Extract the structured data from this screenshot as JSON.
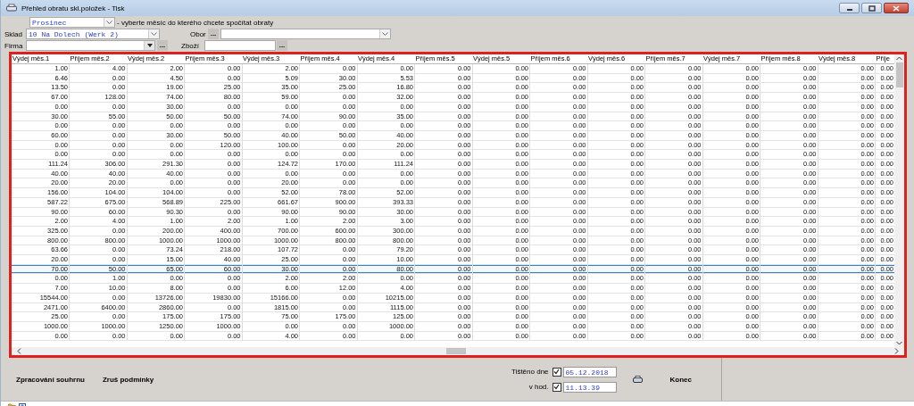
{
  "window": {
    "title": "Přehled obratu skl.položek - Tisk"
  },
  "filters": {
    "month": {
      "value": "Prosinec",
      "hint": "- vyberte měsíc  do kterého chcete spočítat obraty"
    },
    "warehouse": {
      "label": "Sklad",
      "value": "10 Na Dolech (Werk 2)"
    },
    "field": {
      "label": "Obor",
      "browse": "..."
    },
    "company": {
      "label": "Firma",
      "browse": "..."
    },
    "goods": {
      "label": "Zboží",
      "browse": "..."
    }
  },
  "table": {
    "columns": [
      "Výdej měs.1",
      "Příjem měs.2",
      "Výdej měs.2",
      "Příjem měs.3",
      "Výdej měs.3",
      "Příjem měs.4",
      "Výdej měs.4",
      "Příjem měs.5",
      "Výdej měs.5",
      "Příjem měs.6",
      "Výdej měs.6",
      "Příjem měs.7",
      "Výdej měs.7",
      "Příjem měs.8",
      "Výdej měs.8",
      "Příje"
    ],
    "rows": [
      {
        "selected": false,
        "cells": [
          "1.00",
          "4.00",
          "2.00",
          "0.00",
          "2.00",
          "0.00",
          "0.00",
          "0.00",
          "0.00",
          "0.00",
          "0.00",
          "0.00",
          "0.00",
          "0.00",
          "0.00",
          "0.00"
        ]
      },
      {
        "selected": false,
        "cells": [
          "6.46",
          "0.00",
          "4.50",
          "0.00",
          "5.09",
          "30.00",
          "5.53",
          "0.00",
          "0.00",
          "0.00",
          "0.00",
          "0.00",
          "0.00",
          "0.00",
          "0.00",
          "0.00"
        ]
      },
      {
        "selected": false,
        "cells": [
          "13.50",
          "0.00",
          "19.00",
          "25.00",
          "35.00",
          "25.00",
          "16.80",
          "0.00",
          "0.00",
          "0.00",
          "0.00",
          "0.00",
          "0.00",
          "0.00",
          "0.00",
          "0.00"
        ]
      },
      {
        "selected": false,
        "cells": [
          "67.00",
          "128.00",
          "74.00",
          "80.00",
          "59.00",
          "0.00",
          "32.00",
          "0.00",
          "0.00",
          "0.00",
          "0.00",
          "0.00",
          "0.00",
          "0.00",
          "0.00",
          "0.00"
        ]
      },
      {
        "selected": false,
        "cells": [
          "0.00",
          "0.00",
          "30.00",
          "0.00",
          "0.00",
          "0.00",
          "0.00",
          "0.00",
          "0.00",
          "0.00",
          "0.00",
          "0.00",
          "0.00",
          "0.00",
          "0.00",
          "0.00"
        ]
      },
      {
        "selected": false,
        "cells": [
          "30.00",
          "55.00",
          "50.00",
          "50.00",
          "74.00",
          "90.00",
          "35.00",
          "0.00",
          "0.00",
          "0.00",
          "0.00",
          "0.00",
          "0.00",
          "0.00",
          "0.00",
          "0.00"
        ]
      },
      {
        "selected": false,
        "cells": [
          "0.00",
          "0.00",
          "0.00",
          "0.00",
          "0.00",
          "0.00",
          "0.00",
          "0.00",
          "0.00",
          "0.00",
          "0.00",
          "0.00",
          "0.00",
          "0.00",
          "0.00",
          "0.00"
        ]
      },
      {
        "selected": false,
        "cells": [
          "60.00",
          "0.00",
          "30.00",
          "50.00",
          "40.00",
          "50.00",
          "40.00",
          "0.00",
          "0.00",
          "0.00",
          "0.00",
          "0.00",
          "0.00",
          "0.00",
          "0.00",
          "0.00"
        ]
      },
      {
        "selected": false,
        "cells": [
          "0.00",
          "0.00",
          "0.00",
          "120.00",
          "100.00",
          "0.00",
          "20.00",
          "0.00",
          "0.00",
          "0.00",
          "0.00",
          "0.00",
          "0.00",
          "0.00",
          "0.00",
          "0.00"
        ]
      },
      {
        "selected": false,
        "cells": [
          "0.00",
          "0.00",
          "0.00",
          "0.00",
          "0.00",
          "0.00",
          "0.00",
          "0.00",
          "0.00",
          "0.00",
          "0.00",
          "0.00",
          "0.00",
          "0.00",
          "0.00",
          "0.00"
        ]
      },
      {
        "selected": false,
        "cells": [
          "111.24",
          "306.00",
          "291.30",
          "0.00",
          "124.72",
          "170.00",
          "111.24",
          "0.00",
          "0.00",
          "0.00",
          "0.00",
          "0.00",
          "0.00",
          "0.00",
          "0.00",
          "0.00"
        ]
      },
      {
        "selected": false,
        "cells": [
          "40.00",
          "40.00",
          "40.00",
          "0.00",
          "0.00",
          "0.00",
          "0.00",
          "0.00",
          "0.00",
          "0.00",
          "0.00",
          "0.00",
          "0.00",
          "0.00",
          "0.00",
          "0.00"
        ]
      },
      {
        "selected": false,
        "cells": [
          "20.00",
          "20.00",
          "0.00",
          "0.00",
          "20.00",
          "0.00",
          "0.00",
          "0.00",
          "0.00",
          "0.00",
          "0.00",
          "0.00",
          "0.00",
          "0.00",
          "0.00",
          "0.00"
        ]
      },
      {
        "selected": false,
        "cells": [
          "156.00",
          "104.00",
          "104.00",
          "0.00",
          "52.00",
          "78.00",
          "52.00",
          "0.00",
          "0.00",
          "0.00",
          "0.00",
          "0.00",
          "0.00",
          "0.00",
          "0.00",
          "0.00"
        ]
      },
      {
        "selected": false,
        "cells": [
          "587.22",
          "675.00",
          "568.89",
          "225.00",
          "661.67",
          "900.00",
          "393.33",
          "0.00",
          "0.00",
          "0.00",
          "0.00",
          "0.00",
          "0.00",
          "0.00",
          "0.00",
          "0.00"
        ]
      },
      {
        "selected": false,
        "cells": [
          "90.00",
          "60.00",
          "90.30",
          "0.00",
          "90.00",
          "90.00",
          "30.00",
          "0.00",
          "0.00",
          "0.00",
          "0.00",
          "0.00",
          "0.00",
          "0.00",
          "0.00",
          "0.00"
        ]
      },
      {
        "selected": false,
        "cells": [
          "2.00",
          "4.00",
          "1.00",
          "2.00",
          "1.00",
          "2.00",
          "3.00",
          "0.00",
          "0.00",
          "0.00",
          "0.00",
          "0.00",
          "0.00",
          "0.00",
          "0.00",
          "0.00"
        ]
      },
      {
        "selected": false,
        "cells": [
          "325.00",
          "0.00",
          "200.00",
          "400.00",
          "700.00",
          "600.00",
          "300.00",
          "0.00",
          "0.00",
          "0.00",
          "0.00",
          "0.00",
          "0.00",
          "0.00",
          "0.00",
          "0.00"
        ]
      },
      {
        "selected": false,
        "cells": [
          "800.00",
          "800.00",
          "1000.00",
          "1000.00",
          "1000.00",
          "800.00",
          "800.00",
          "0.00",
          "0.00",
          "0.00",
          "0.00",
          "0.00",
          "0.00",
          "0.00",
          "0.00",
          "0.00"
        ]
      },
      {
        "selected": false,
        "cells": [
          "63.66",
          "0.00",
          "73.24",
          "218.00",
          "107.72",
          "0.00",
          "79.20",
          "0.00",
          "0.00",
          "0.00",
          "0.00",
          "0.00",
          "0.00",
          "0.00",
          "0.00",
          "0.00"
        ]
      },
      {
        "selected": false,
        "cells": [
          "20.00",
          "0.00",
          "15.00",
          "40.00",
          "25.00",
          "0.00",
          "10.00",
          "0.00",
          "0.00",
          "0.00",
          "0.00",
          "0.00",
          "0.00",
          "0.00",
          "0.00",
          "0.00"
        ]
      },
      {
        "selected": true,
        "cells": [
          "70.00",
          "50.00",
          "65.00",
          "60.00",
          "30.00",
          "0.00",
          "80.00",
          "0.00",
          "0.00",
          "0.00",
          "0.00",
          "0.00",
          "0.00",
          "0.00",
          "0.00",
          "0.00"
        ]
      },
      {
        "selected": false,
        "cells": [
          "0.00",
          "1.00",
          "0.00",
          "0.00",
          "2.00",
          "2.00",
          "0.00",
          "0.00",
          "0.00",
          "0.00",
          "0.00",
          "0.00",
          "0.00",
          "0.00",
          "0.00",
          "0.00"
        ]
      },
      {
        "selected": false,
        "cells": [
          "7.00",
          "10.00",
          "8.00",
          "0.00",
          "6.00",
          "12.00",
          "4.00",
          "0.00",
          "0.00",
          "0.00",
          "0.00",
          "0.00",
          "0.00",
          "0.00",
          "0.00",
          "0.00"
        ]
      },
      {
        "selected": false,
        "cells": [
          "15544.00",
          "0.00",
          "13726.00",
          "19830.00",
          "15166.00",
          "0.00",
          "10215.00",
          "0.00",
          "0.00",
          "0.00",
          "0.00",
          "0.00",
          "0.00",
          "0.00",
          "0.00",
          "0.00"
        ]
      },
      {
        "selected": false,
        "cells": [
          "2471.00",
          "6400.00",
          "2860.00",
          "0.00",
          "1815.00",
          "0.00",
          "1115.00",
          "0.00",
          "0.00",
          "0.00",
          "0.00",
          "0.00",
          "0.00",
          "0.00",
          "0.00",
          "0.00"
        ]
      },
      {
        "selected": false,
        "cells": [
          "25.00",
          "0.00",
          "175.00",
          "175.00",
          "75.00",
          "175.00",
          "125.00",
          "0.00",
          "0.00",
          "0.00",
          "0.00",
          "0.00",
          "0.00",
          "0.00",
          "0.00",
          "0.00"
        ]
      },
      {
        "selected": false,
        "cells": [
          "1000.00",
          "1000.00",
          "1250.00",
          "1000.00",
          "0.00",
          "0.00",
          "1000.00",
          "0.00",
          "0.00",
          "0.00",
          "0.00",
          "0.00",
          "0.00",
          "0.00",
          "0.00",
          "0.00"
        ]
      },
      {
        "selected": false,
        "cells": [
          "0.00",
          "0.00",
          "0.00",
          "0.00",
          "4.00",
          "0.00",
          "0.00",
          "0.00",
          "0.00",
          "0.00",
          "0.00",
          "0.00",
          "0.00",
          "0.00",
          "0.00",
          "0.00"
        ]
      }
    ]
  },
  "footer": {
    "buttons": [
      "Zpracování souhrnu",
      "Zruš podmínky"
    ],
    "printed_date": {
      "label": "Tištěno dne",
      "checked": true,
      "value": "05.12.2018"
    },
    "printed_time": {
      "label": "v hod.",
      "checked": true,
      "value": "11.13.39"
    },
    "close": "Konec"
  }
}
